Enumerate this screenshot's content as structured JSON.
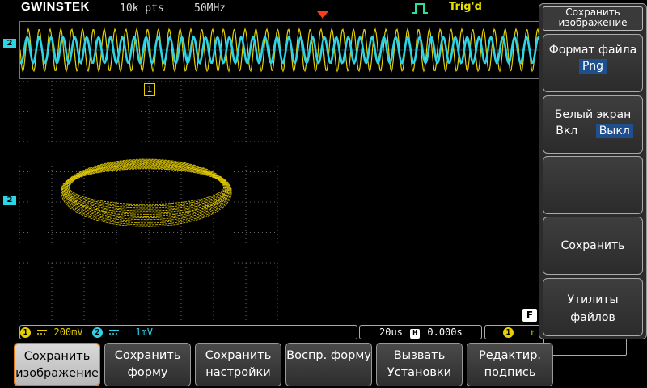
{
  "top": {
    "brand": "GWINSTEK",
    "record_length": "10k pts",
    "sample_rate": "50MHz",
    "trigger_state": "Trig'd"
  },
  "markers": {
    "ch2_overview": "2",
    "ch2_main": "2",
    "ch1_top": "1"
  },
  "status": {
    "ch1_num": "1",
    "ch1_scale": "200mV",
    "ch2_num": "2",
    "ch2_scale": "1mV",
    "timebase": "20us",
    "h_icon": "H",
    "position": "0.000s",
    "trig_src": "1",
    "f_icon": "F"
  },
  "side_menu": {
    "title": "Сохранить изображение",
    "file_format_label": "Формат файла",
    "file_format_value": "Png",
    "ink_saver_label": "Белый экран",
    "ink_on": "Вкл",
    "ink_off": "Выкл",
    "save": "Сохранить",
    "file_utils": "Утилиты файлов"
  },
  "softkeys": [
    "Сохранить изображение",
    "Сохранить форму",
    "Сохранить настройки",
    "Воспр. форму",
    "Вызвать Установки",
    "Редактир. подпись"
  ],
  "colors": {
    "ch1": "#e8d000",
    "ch2": "#2ed3e6",
    "active_outline": "#e07b1f",
    "selection": "#1f4f8c"
  }
}
